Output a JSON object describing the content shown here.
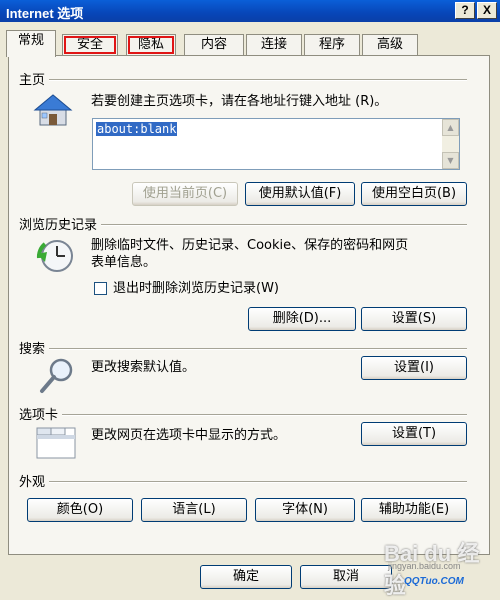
{
  "window": {
    "title": "Internet 选项",
    "help_btn": "?",
    "close_btn": "X"
  },
  "tabs": [
    {
      "label": "常规",
      "active": true
    },
    {
      "label": "安全"
    },
    {
      "label": "隐私"
    },
    {
      "label": "内容"
    },
    {
      "label": "连接"
    },
    {
      "label": "程序"
    },
    {
      "label": "高级"
    }
  ],
  "home": {
    "title": "主页",
    "description": "若要创建主页选项卡，请在各地址行键入地址 (R)。",
    "url": "about:blank",
    "use_current": "使用当前页(C)",
    "use_default": "使用默认值(F)",
    "use_blank": "使用空白页(B)"
  },
  "history": {
    "title": "浏览历史记录",
    "description_line1": "删除临时文件、历史记录、Cookie、保存的密码和网页",
    "description_line2": "表单信息。",
    "checkbox_label": "退出时删除浏览历史记录(W)",
    "checkbox_checked": false,
    "delete_btn": "删除(D)...",
    "settings_btn": "设置(S)"
  },
  "search": {
    "title": "搜索",
    "description": "更改搜索默认值。",
    "settings_btn": "设置(I)"
  },
  "tabs_section": {
    "title": "选项卡",
    "description": "更改网页在选项卡中显示的方式。",
    "settings_btn": "设置(T)"
  },
  "appearance": {
    "title": "外观",
    "colors_btn": "颜色(O)",
    "languages_btn": "语言(L)",
    "fonts_btn": "字体(N)",
    "accessibility_btn": "辅助功能(E)"
  },
  "footer": {
    "ok_btn": "确定",
    "cancel_btn": "取消"
  },
  "watermark": {
    "logo": "Bai du 经验",
    "url": "jingyan.baidu.com",
    "qq": "QQTuo.COM"
  },
  "colors": {
    "titlebar": "#0a5fd8",
    "highlight_outline": "#e01515",
    "selection": "#316ac5"
  }
}
